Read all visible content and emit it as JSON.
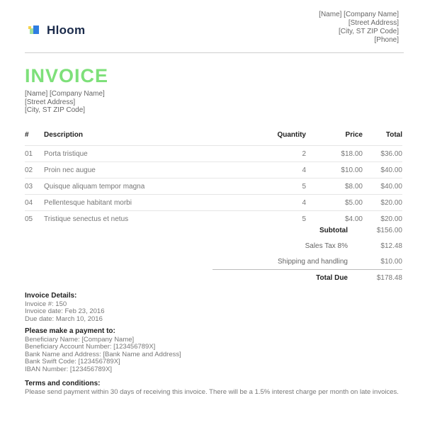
{
  "logo": {
    "text": "Hloom"
  },
  "company": {
    "line1": "[Name]   [Company Name]",
    "line2": "[Street Address]",
    "line3": "[City, ST ZIP Code]",
    "line4": "[Phone]"
  },
  "title": "INVOICE",
  "client": {
    "line1": "[Name]   [Company Name]",
    "line2": "[Street Address]",
    "line3": "[City, ST ZIP Code]"
  },
  "table": {
    "headers": {
      "num": "#",
      "desc": "Description",
      "qty": "Quantity",
      "price": "Price",
      "total": "Total"
    },
    "rows": [
      {
        "num": "01",
        "desc": "Porta tristique",
        "qty": "2",
        "price": "$18.00",
        "total": "$36.00"
      },
      {
        "num": "02",
        "desc": "Proin nec augue",
        "qty": "4",
        "price": "$10.00",
        "total": "$40.00"
      },
      {
        "num": "03",
        "desc": "Quisque aliquam tempor magna",
        "qty": "5",
        "price": "$8.00",
        "total": "$40.00"
      },
      {
        "num": "04",
        "desc": "Pellentesque habitant morbi",
        "qty": "4",
        "price": "$5.00",
        "total": "$20.00"
      },
      {
        "num": "05",
        "desc": "Tristique senectus et netus",
        "qty": "5",
        "price": "$4.00",
        "total": "$20.00"
      }
    ]
  },
  "summary": {
    "subtotal_label": "Subtotal",
    "subtotal": "$156.00",
    "tax_label": "Sales Tax 8%",
    "tax": "$12.48",
    "shipping_label": "Shipping and handling",
    "shipping": "$10.00",
    "due_label": "Total Due",
    "due": "$178.48"
  },
  "details": {
    "heading": "Invoice Details:",
    "number": "Invoice #: 150",
    "date": "Invoice date: Feb 23, 2016",
    "due_date": "Due date: March 10, 2016"
  },
  "payment": {
    "heading": "Please make a payment to:",
    "line1": "Beneficiary Name: [Company Name]",
    "line2": "Beneficiary Account Number: [123456789X]",
    "line3": "Bank Name and Address: [Bank Name and Address]",
    "line4": "Bank Swift Code: [123456789X]",
    "line5": "IBAN Number: [123456789X]"
  },
  "terms": {
    "heading": "Terms and conditions:",
    "text": "Please send payment within 30 days of receiving this invoice. There will be a 1.5% interest charge per month on late invoices."
  },
  "colors": {
    "title": "#7ee07a",
    "text": "#555555",
    "rule": "#cfcfcf"
  }
}
